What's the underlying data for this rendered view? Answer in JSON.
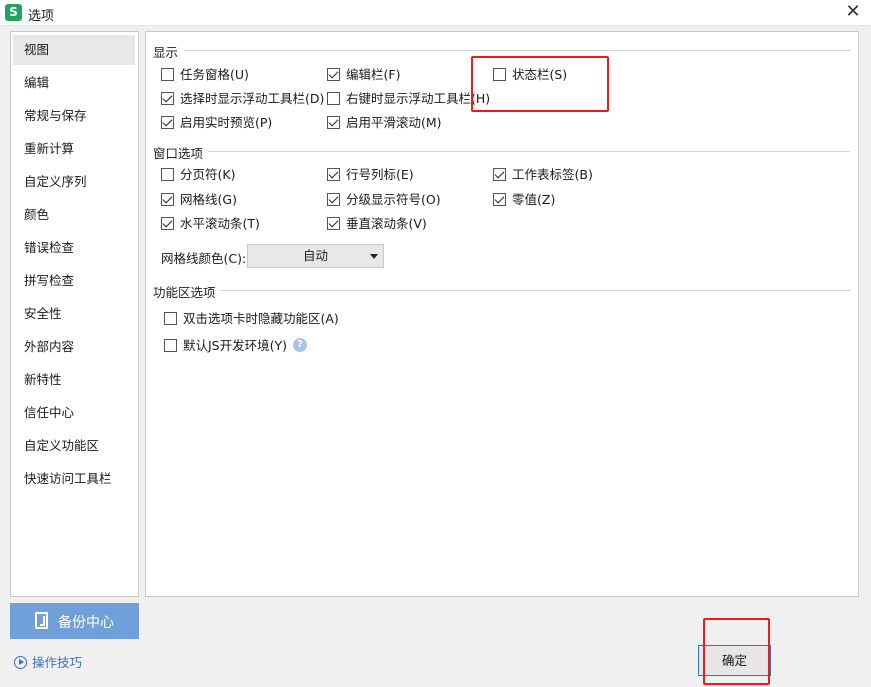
{
  "window": {
    "title": "选项",
    "app_icon_letter": "S"
  },
  "sidebar": {
    "items": [
      {
        "label": "视图",
        "active": true
      },
      {
        "label": "编辑"
      },
      {
        "label": "常规与保存"
      },
      {
        "label": "重新计算"
      },
      {
        "label": "自定义序列"
      },
      {
        "label": "颜色"
      },
      {
        "label": "错误检查"
      },
      {
        "label": "拼写检查"
      },
      {
        "label": "安全性"
      },
      {
        "label": "外部内容"
      },
      {
        "label": "新特性"
      },
      {
        "label": "信任中心"
      },
      {
        "label": "自定义功能区"
      },
      {
        "label": "快速访问工具栏"
      }
    ]
  },
  "display": {
    "title": "显示",
    "options": [
      {
        "label": "任务窗格(U)",
        "checked": false
      },
      {
        "label": "编辑栏(F)",
        "checked": true
      },
      {
        "label": "状态栏(S)",
        "checked": false
      },
      {
        "label": "选择时显示浮动工具栏(D)",
        "checked": true
      },
      {
        "label": "右键时显示浮动工具栏(H)",
        "checked": false
      },
      {
        "label": "启用实时预览(P)",
        "checked": true
      },
      {
        "label": "启用平滑滚动(M)",
        "checked": true
      }
    ]
  },
  "window_options": {
    "title": "窗口选项",
    "options": [
      {
        "label": "分页符(K)",
        "checked": false
      },
      {
        "label": "行号列标(E)",
        "checked": true
      },
      {
        "label": "工作表标签(B)",
        "checked": true
      },
      {
        "label": "网格线(G)",
        "checked": true
      },
      {
        "label": "分级显示符号(O)",
        "checked": true
      },
      {
        "label": "零值(Z)",
        "checked": true
      },
      {
        "label": "水平滚动条(T)",
        "checked": true
      },
      {
        "label": "垂直滚动条(V)",
        "checked": true
      }
    ],
    "grid_color_label": "网格线颜色(C):",
    "grid_color_value": "自动"
  },
  "ribbon": {
    "title": "功能区选项",
    "options": [
      {
        "label": "双击选项卡时隐藏功能区(A)",
        "checked": false
      },
      {
        "label": "默认JS开发环境(Y)",
        "checked": false
      }
    ],
    "help_glyph": "?"
  },
  "footer": {
    "backup_label": "备份中心",
    "tips_label": "操作技巧",
    "ok_label": "确定"
  },
  "colors": {
    "highlight": "#ee1b1b",
    "backup_button": "#6fa0d9",
    "link": "#3a70c0"
  }
}
